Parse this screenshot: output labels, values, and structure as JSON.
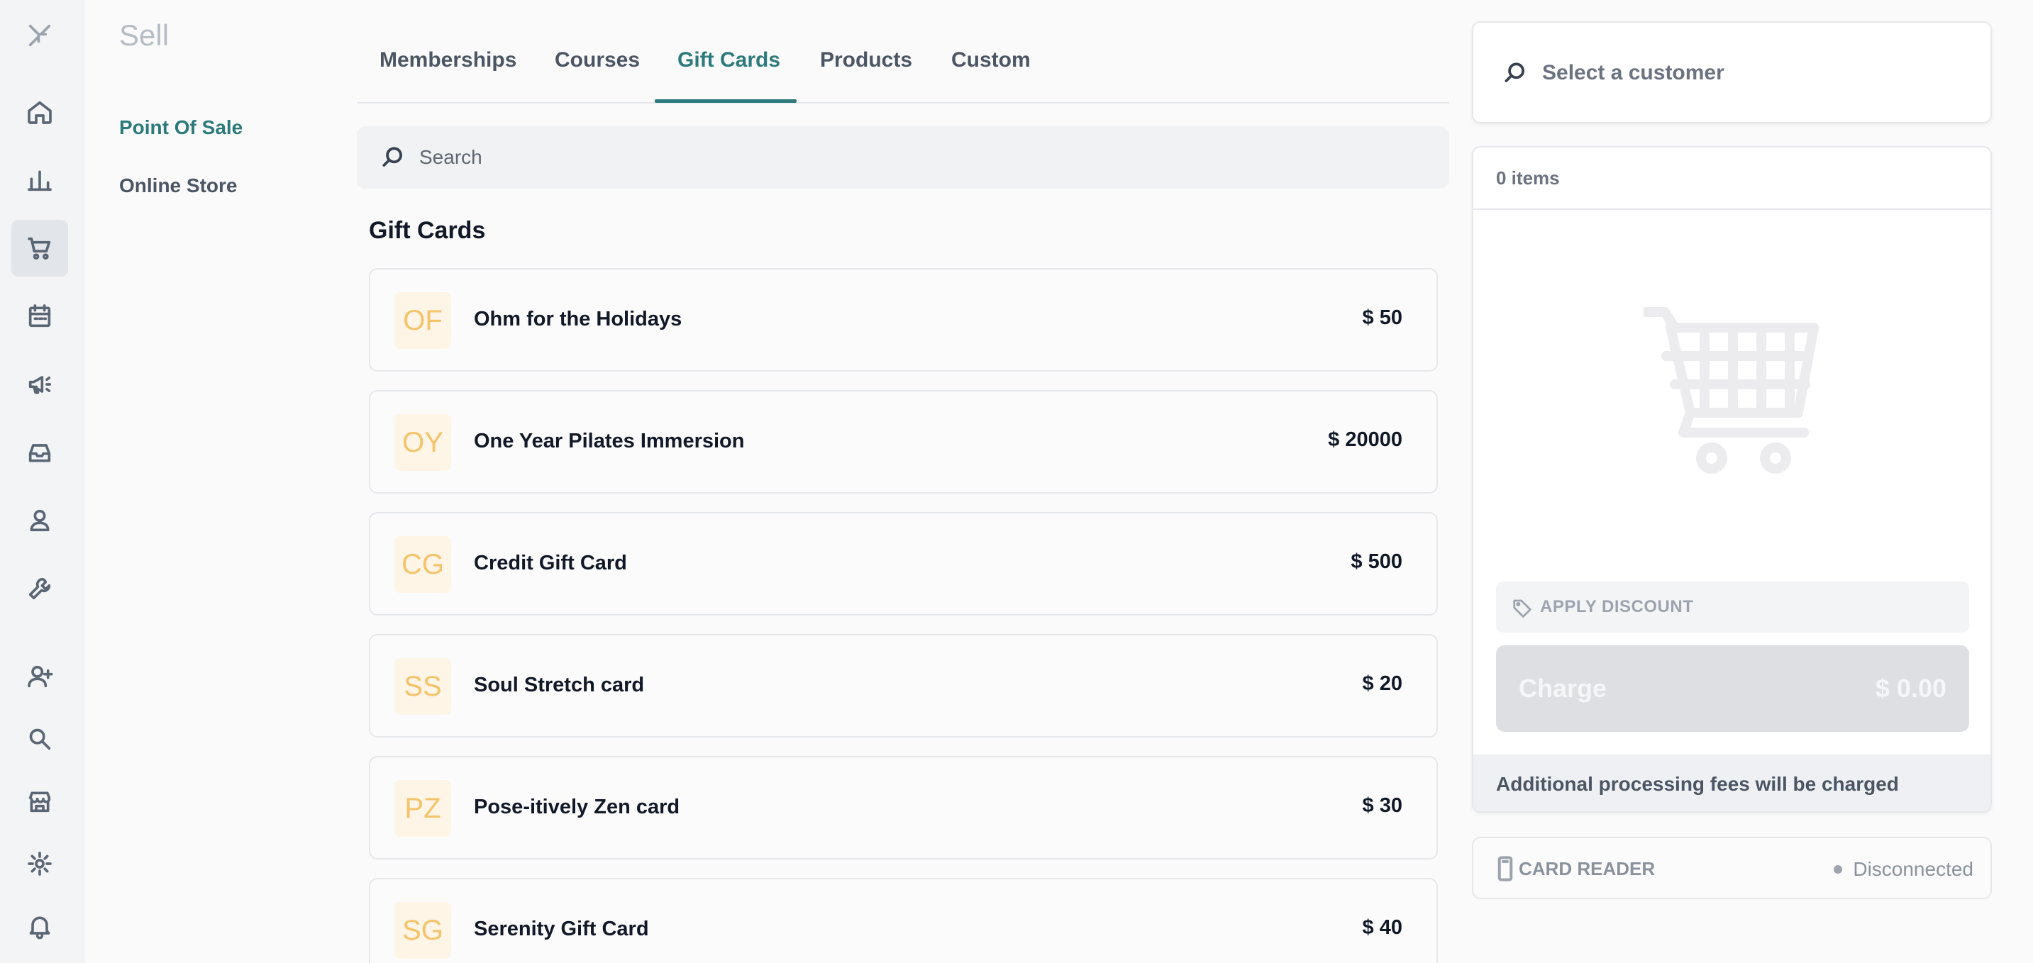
{
  "rail": {
    "items": [
      {
        "icon": "logo-icon"
      },
      {
        "icon": "home-icon"
      },
      {
        "icon": "bar-chart-icon"
      },
      {
        "icon": "shopping-cart-icon",
        "active": true
      },
      {
        "icon": "calendar-icon"
      },
      {
        "icon": "megaphone-icon"
      },
      {
        "icon": "inbox-icon"
      },
      {
        "icon": "user-icon"
      },
      {
        "icon": "wrench-icon"
      },
      {
        "icon": "add-user-icon"
      },
      {
        "icon": "search-icon"
      },
      {
        "icon": "store-icon"
      },
      {
        "icon": "gear-icon"
      },
      {
        "icon": "bell-icon"
      }
    ]
  },
  "subnav": {
    "title": "Sell",
    "items": [
      {
        "label": "Point Of Sale",
        "active": true
      },
      {
        "label": "Online Store",
        "active": false
      }
    ]
  },
  "tabs": [
    {
      "label": "Memberships"
    },
    {
      "label": "Courses"
    },
    {
      "label": "Gift Cards",
      "active": true
    },
    {
      "label": "Products"
    },
    {
      "label": "Custom"
    }
  ],
  "search": {
    "placeholder": "Search",
    "value": "",
    "icon": "search-icon"
  },
  "section": {
    "title": "Gift Cards"
  },
  "gift_cards": [
    {
      "initials": "OF",
      "name": "Ohm for the Holidays",
      "price": "$ 50"
    },
    {
      "initials": "OY",
      "name": "One Year Pilates Immersion",
      "price": "$ 20000"
    },
    {
      "initials": "CG",
      "name": "Credit Gift Card",
      "price": "$ 500"
    },
    {
      "initials": "SS",
      "name": "Soul Stretch card",
      "price": "$ 20"
    },
    {
      "initials": "PZ",
      "name": "Pose-itively Zen card",
      "price": "$ 30"
    },
    {
      "initials": "SG",
      "name": "Serenity Gift Card",
      "price": "$ 40"
    }
  ],
  "customer": {
    "placeholder": "Select a customer",
    "icon": "search-icon"
  },
  "cart": {
    "count_label": "0 items",
    "empty_icon": "empty-cart-icon",
    "discount_label": "APPLY DISCOUNT",
    "discount_icon": "tag-icon",
    "charge_label": "Charge",
    "charge_amount": "$ 0.00",
    "fees_note": "Additional processing fees will be charged"
  },
  "card_reader": {
    "label": "CARD READER",
    "icon": "card-reader-icon",
    "status": "Disconnected"
  },
  "colors": {
    "accent": "#2c7a7b",
    "badge_bg": "#fef5e6",
    "badge_text": "#f5c36a",
    "charge_disabled": "#dddfe3"
  }
}
